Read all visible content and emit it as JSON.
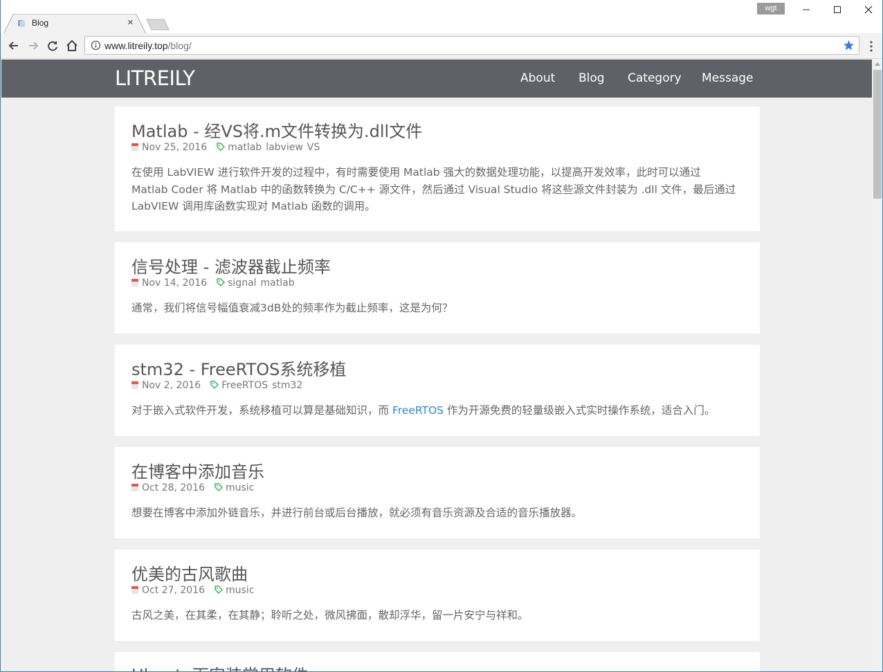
{
  "browser": {
    "tab_title": "Blog",
    "tab_close": "×",
    "profile": "wgt",
    "window_controls": {
      "minimize": "—",
      "maximize": "☐",
      "close": "✕"
    },
    "url_host": "www.litreily.top",
    "url_path": "/blog/",
    "icons": [
      "back-arrow-icon",
      "forward-arrow-icon",
      "reload-icon",
      "home-icon",
      "info-icon",
      "star-icon",
      "menu-icon"
    ]
  },
  "site": {
    "brand": "LITREILY",
    "nav": {
      "about": "About",
      "blog": "Blog",
      "category": "Category",
      "message": "Message"
    }
  },
  "posts": [
    {
      "title": "Matlab - 经VS将.m文件转换为.dll文件",
      "date": "Nov 25, 2016",
      "tags": [
        "matlab",
        "labview",
        "VS"
      ],
      "excerpt": "在使用 LabVIEW 进行软件开发的过程中，有时需要使用 Matlab 强大的数据处理功能，以提高开发效率，此时可以通过 Matlab Coder 将 Matlab 中的函数转换为 C/C++ 源文件，然后通过 Visual Studio 将这些源文件封装为 .dll 文件，最后通过 LabVIEW 调用库函数实现对 Matlab 函数的调用。"
    },
    {
      "title": "信号处理 - 滤波器截止频率",
      "date": "Nov 14, 2016",
      "tags": [
        "signal",
        "matlab"
      ],
      "excerpt": "通常，我们将信号幅值衰减3dB处的频率作为截止频率，这是为何？"
    },
    {
      "title": "stm32 - FreeRTOS系统移植",
      "date": "Nov 2, 2016",
      "tags": [
        "FreeRTOS",
        "stm32"
      ],
      "excerpt_before": "对于嵌入式软件开发，系统移植可以算是基础知识，而 ",
      "excerpt_link": "FreeRTOS",
      "excerpt_after": " 作为开源免费的轻量级嵌入式实时操作系统，适合入门。"
    },
    {
      "title": "在博客中添加音乐",
      "date": "Oct 28, 2016",
      "tags": [
        "music"
      ],
      "excerpt": "想要在博客中添加外链音乐，并进行前台或后台播放，就必须有音乐资源及合适的音乐播放器。"
    },
    {
      "title": "优美的古风歌曲",
      "date": "Oct 27, 2016",
      "tags": [
        "music"
      ],
      "excerpt": "古风之美，在其柔，在其静；聆听之处，微风拂面，散却浮华，留一片安宁与祥和。"
    },
    {
      "title": "Ubuntu下安装常用软件"
    }
  ]
}
